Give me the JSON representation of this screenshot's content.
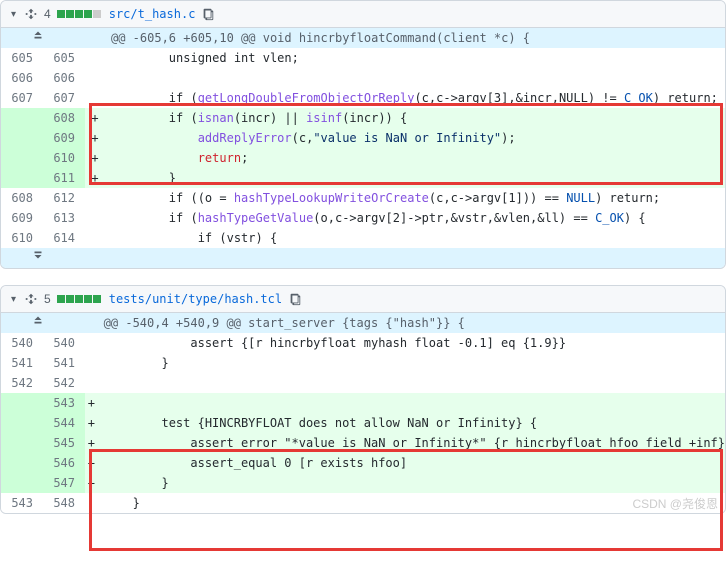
{
  "files": [
    {
      "changes": "4",
      "path": "src/t_hash.c",
      "hunk_header": "@@ -605,6 +605,10 @@ void hincrbyfloatCommand(client *c) {",
      "lines": {
        "l605": {
          "old": "605",
          "new": "605",
          "sign": " ",
          "code": "        unsigned int vlen;"
        },
        "l606": {
          "old": "606",
          "new": "606",
          "sign": " ",
          "code": ""
        },
        "l607": {
          "old": "607",
          "new": "607",
          "sign": " "
        },
        "l608": {
          "old": "",
          "new": "608",
          "sign": "+"
        },
        "l609": {
          "old": "",
          "new": "609",
          "sign": "+"
        },
        "l610": {
          "old": "",
          "new": "610",
          "sign": "+"
        },
        "l611": {
          "old": "",
          "new": "611",
          "sign": "+",
          "code": "        }"
        },
        "l612": {
          "old": "608",
          "new": "612",
          "sign": " "
        },
        "l613": {
          "old": "609",
          "new": "613",
          "sign": " "
        },
        "l614": {
          "old": "610",
          "new": "614",
          "sign": " "
        }
      },
      "code": {
        "getlongdbl_pre": "        if (",
        "getlongdbl": "getLongDoubleFromObjectOrReply",
        "getlongdbl_args": "(c,c->argv[3],&incr,NULL) != ",
        "c_ok": "C_OK",
        "getlongdbl_end": ") return;",
        "isnan_pre": "        if (",
        "isnan": "isnan",
        "isnan_args": "(incr) || ",
        "isinf": "isinf",
        "isinf_args": "(incr)) {",
        "addreply_pre": "            ",
        "addreply": "addReplyError",
        "addreply_args1": "(c,",
        "addreply_str": "\"value is NaN or Infinity\"",
        "addreply_args2": ");",
        "return_pre": "            ",
        "return": "return",
        "return_post": ";",
        "lookup_pre": "        if ((o = ",
        "lookup": "hashTypeLookupWriteOrCreate",
        "lookup_args": "(c,c->argv[1])) == ",
        "null": "NULL",
        "lookup_end": ") return;",
        "getval_pre": "        if (",
        "getval": "hashTypeGetValue",
        "getval_args": "(o,c->argv[2]->ptr,&vstr,&vlen,&ll) == ",
        "getval_end": ") {",
        "vstr": "            if (vstr) {"
      }
    },
    {
      "changes": "5",
      "path": "tests/unit/type/hash.tcl",
      "hunk_header": "@@ -540,4 +540,9 @@ start_server {tags {\"hash\"}} {",
      "lines": {
        "l540": {
          "old": "540",
          "new": "540",
          "sign": " ",
          "code": "            assert {[r hincrbyfloat myhash float -0.1] eq {1.9}}"
        },
        "l541": {
          "old": "541",
          "new": "541",
          "sign": " ",
          "code": "        }"
        },
        "l542": {
          "old": "542",
          "new": "542",
          "sign": " ",
          "code": ""
        },
        "l543": {
          "old": "",
          "new": "543",
          "sign": "+",
          "code": ""
        },
        "l544": {
          "old": "",
          "new": "544",
          "sign": "+",
          "code": "        test {HINCRBYFLOAT does not allow NaN or Infinity} {"
        },
        "l545": {
          "old": "",
          "new": "545",
          "sign": "+",
          "code": "            assert_error \"*value is NaN or Infinity*\" {r hincrbyfloat hfoo field +inf}"
        },
        "l546": {
          "old": "",
          "new": "546",
          "sign": "+",
          "code": "            assert_equal 0 [r exists hfoo]"
        },
        "l547": {
          "old": "",
          "new": "547",
          "sign": "+",
          "code": "        }"
        },
        "l548": {
          "old": "543",
          "new": "548",
          "sign": " ",
          "code": "    }"
        }
      }
    }
  ],
  "watermark": "CSDN @尧俊恩"
}
